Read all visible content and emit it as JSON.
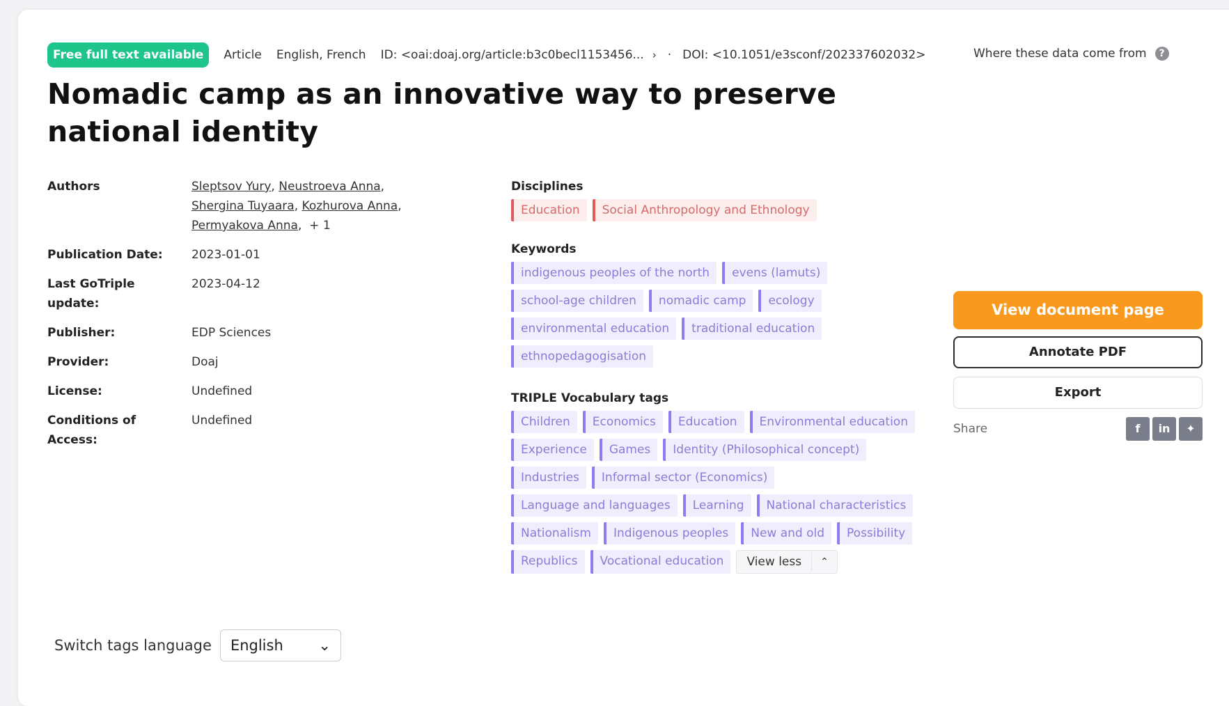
{
  "top": {
    "badge": "Free full text available",
    "type": "Article",
    "languages": "English, French",
    "id": "ID: <oai:doaj.org/article:b3c0becl1153456...",
    "dot": "·",
    "doi": "DOI: <10.1051/e3sconf/202337602032>",
    "where": "Where these data come from"
  },
  "title": "Nomadic camp as an innovative way to preserve national identity",
  "meta": {
    "authors_label": "Authors",
    "authors": [
      "Sleptsov Yury",
      "Neustroeva Anna",
      "Shergina Tuyaara",
      "Kozhurova Anna",
      "Permyakova Anna"
    ],
    "authors_more": "+ 1",
    "pubdate_label": "Publication Date:",
    "pubdate": "2023-01-01",
    "update_label": "Last GoTriple update:",
    "update": "2023-04-12",
    "publisher_label": "Publisher:",
    "publisher": "EDP Sciences",
    "provider_label": "Provider:",
    "provider": "Doaj",
    "license_label": "License:",
    "license": "Undefined",
    "access_label": "Conditions of Access:",
    "access": "Undefined"
  },
  "disciplines": {
    "title": "Disciplines",
    "items": [
      "Education",
      "Social Anthropology and Ethnology"
    ]
  },
  "keywords": {
    "title": "Keywords",
    "items": [
      "indigenous peoples of the north",
      "evens (lamuts)",
      "school-age children",
      "nomadic camp",
      "ecology",
      "environmental education",
      "traditional education",
      "ethnopedagogisation"
    ]
  },
  "vocab": {
    "title": "TRIPLE Vocabulary tags",
    "items": [
      "Children",
      "Economics",
      "Education",
      "Environmental education",
      "Experience",
      "Games",
      "Identity (Philosophical concept)",
      "Industries",
      "Informal sector (Economics)",
      "Language and languages",
      "Learning",
      "National characteristics",
      "Nationalism",
      "Indigenous peoples",
      "New and old",
      "Possibility",
      "Republics",
      "Vocational education"
    ],
    "view_less": "View less"
  },
  "actions": {
    "view": "View document page",
    "annotate": "Annotate PDF",
    "export": "Export",
    "share": "Share"
  },
  "lang": {
    "label": "Switch tags language",
    "selected": "English"
  },
  "colors": {
    "badge": "#1ec58b",
    "primary": "#f99a1e",
    "discipline": "#e25b5b",
    "tag": "#8f7cf0"
  }
}
